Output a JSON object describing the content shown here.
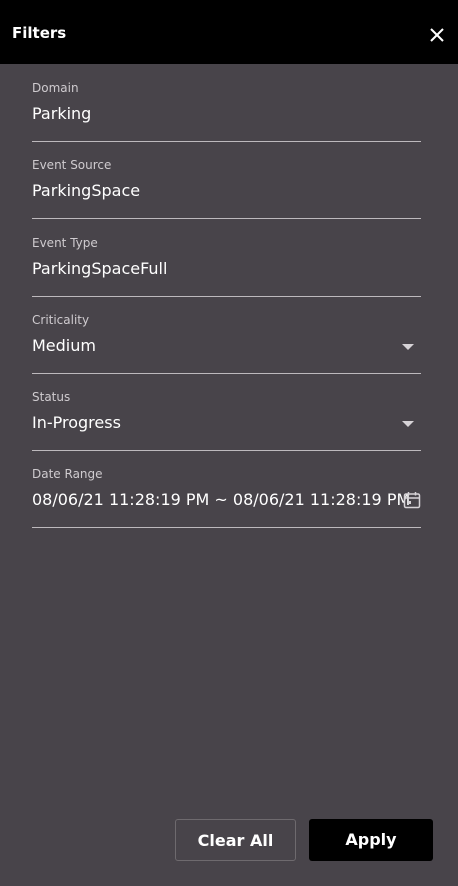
{
  "header": {
    "title": "Filters",
    "close_icon": "close-icon"
  },
  "fields": {
    "domain": {
      "label": "Domain",
      "value": "Parking"
    },
    "event_source": {
      "label": "Event Source",
      "value": "ParkingSpace"
    },
    "event_type": {
      "label": "Event Type",
      "value": "ParkingSpaceFull"
    },
    "criticality": {
      "label": "Criticality",
      "value": "Medium",
      "icon": "chevron-down-icon"
    },
    "status": {
      "label": "Status",
      "value": "In-Progress",
      "icon": "chevron-down-icon"
    },
    "date_range": {
      "label": "Date Range",
      "value": "08/06/21 11:28:19 PM ~ 08/06/21 11:28:19 PM",
      "icon": "calendar-icon"
    }
  },
  "actions": {
    "clear_label": "Clear All",
    "apply_label": "Apply"
  },
  "colors": {
    "header_bg": "#000000",
    "panel_bg": "#48444a",
    "apply_bg": "#000000",
    "text": "#ffffff"
  }
}
